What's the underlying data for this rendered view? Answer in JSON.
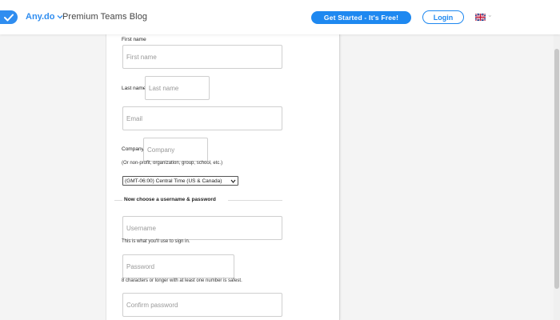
{
  "header": {
    "brand": "Any.do",
    "blog_name": "Premium Teams Blog",
    "cta_label": "Get Started - It's Free!",
    "login_label": "Login",
    "language_icon": "uk-flag-icon"
  },
  "form": {
    "first_name_label": "First name",
    "first_name_placeholder": "First name",
    "last_name_label": "Last name",
    "last_name_placeholder": "Last name",
    "email_placeholder": "Email",
    "company_label": "Company",
    "company_placeholder": "Company",
    "company_hint": "(Or non-profit, organization, group, school, etc.)",
    "timezone_value": "(GMT-06:00) Central Time (US & Canada)",
    "section_heading": "Now choose a username & password",
    "username_placeholder": "Username",
    "username_hint": "This is what you'll use to sign in.",
    "password_placeholder": "Password",
    "password_hint": "8 characters or longer with at least one number is safest.",
    "confirm_password_placeholder": "Confirm password"
  },
  "colors": {
    "accent": "#1e88f0",
    "page_background": "#f4f4f4"
  }
}
